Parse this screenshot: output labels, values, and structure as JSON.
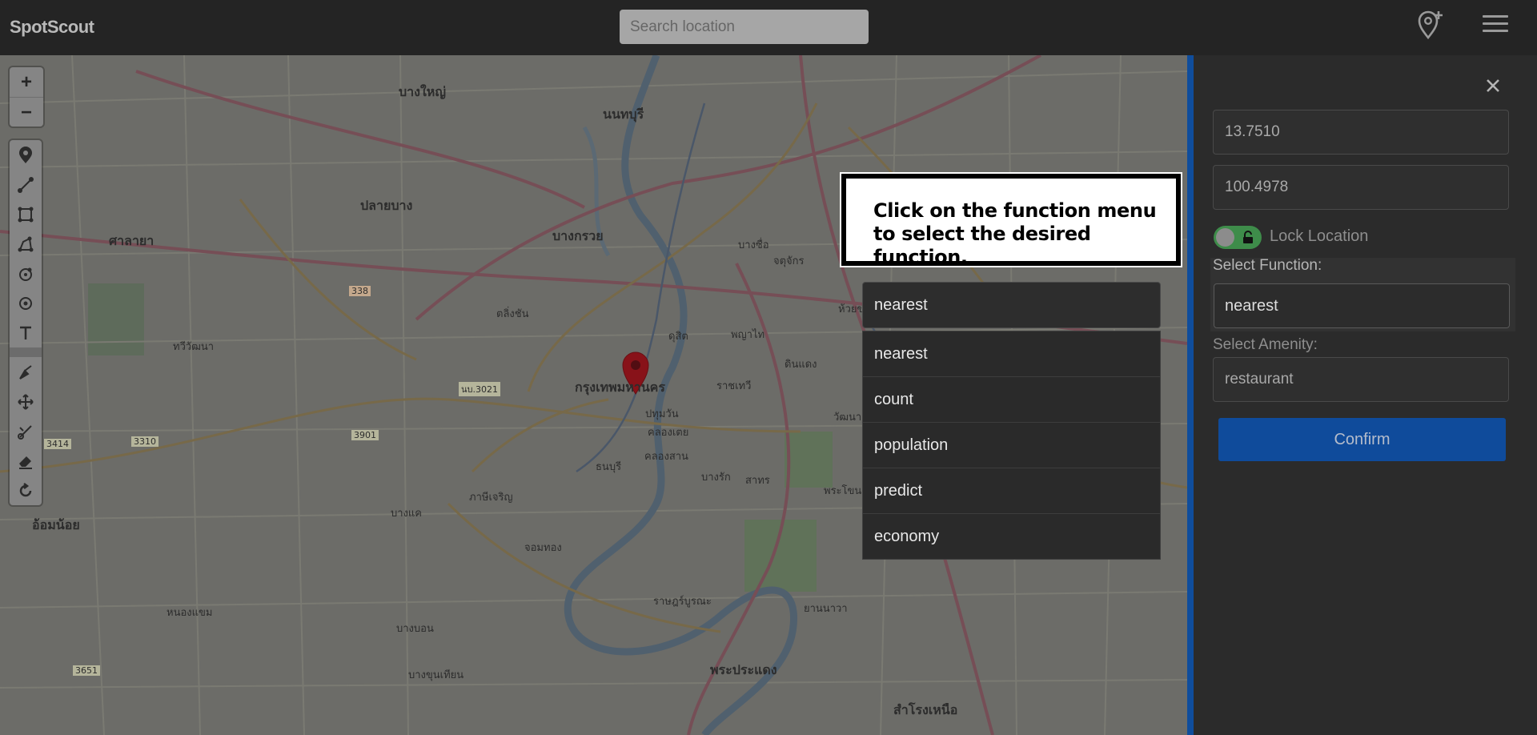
{
  "app": {
    "brand": "SpotScout"
  },
  "header": {
    "search_placeholder": "Search location",
    "add_location_icon": "map-pin-plus-icon",
    "menu_icon": "hamburger-menu-icon"
  },
  "map": {
    "zoom_in": "+",
    "zoom_out": "−",
    "labels": {
      "city": "กรุงเทพมหานคร",
      "nonthaburi": "นนทบุรี",
      "bang_kruai": "บางกรวย",
      "sala_ya": "ศาลายา",
      "om_noi": "อ้อมน้อย",
      "bang_yai": "บางใหญ่",
      "pak_kret": "ปลายบาง",
      "phra_pradaeng": "พระประแดง",
      "samrong_nuea": "สำโรงเหนือ",
      "phasi_charoen": "ภาษีเจริญ",
      "bang_khae": "บางแค",
      "chom_thong": "จอมทอง",
      "thawi_watthana": "ทวีวัฒนา",
      "taling_chan": "ตลิ่งชัน",
      "nong_khaem": "หนองแขม",
      "bang_bon": "บางบอน",
      "bang_khun_thian": "บางขุนเทียน",
      "dusit": "ดุสิต",
      "phaya_thai": "พญาไท",
      "din_daeng": "ดินแดง",
      "ratchathewi": "ราชเทวี",
      "pathum_wan": "ปทุมวัน",
      "khlong_toei": "คลองเตย",
      "sathon": "สาทร",
      "bang_rak": "บางรัก",
      "khlong_san": "คลองสาน",
      "ratburana": "ราษฎร์บูรณะ",
      "yan_nawa": "ยานนาวา",
      "phra_khanong": "พระโขนง",
      "bang_sue": "บางซื่อ",
      "chatuchak": "จตุจักร",
      "huai_khwang": "ห้วยขวาง",
      "wang_thonglang": "วัฒนา",
      "thonburi": "ธนบุรี",
      "route_338": "338",
      "route_3414": "3414",
      "route_3310": "3310",
      "route_3901": "3901",
      "route_3651": "3651",
      "route_3021": "นบ.3021"
    }
  },
  "tools": [
    "marker-icon",
    "polyline-icon",
    "rectangle-icon",
    "polygon-icon",
    "circle-marker-icon",
    "circle-icon",
    "text-icon",
    "edit-icon",
    "move-icon",
    "cut-icon",
    "eraser-icon",
    "rotate-icon"
  ],
  "tooltip": {
    "text": "Click on the function menu to select the desired function."
  },
  "dropdown": {
    "selected": "nearest",
    "options": [
      "nearest",
      "count",
      "population",
      "predict",
      "economy"
    ]
  },
  "panel": {
    "latitude": "13.7510",
    "longitude": "100.4978",
    "lock_label": "Lock Location",
    "function_label": "Select Function:",
    "function_value": "nearest",
    "amenity_label": "Select Amenity:",
    "amenity_value": "restaurant",
    "confirm_label": "Confirm"
  },
  "colors": {
    "accent": "#0f4b9b",
    "toggle_on": "#3e8c4a",
    "marker": "#b8141f"
  }
}
